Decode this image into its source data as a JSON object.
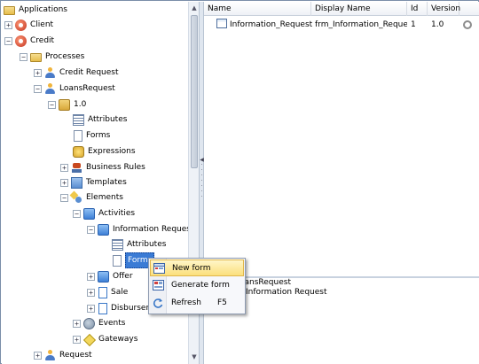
{
  "tree": {
    "nodes": [
      {
        "label": "Applications",
        "icon": "folder-icon"
      },
      {
        "label": "Client",
        "icon": "application-icon"
      },
      {
        "label": "Credit",
        "icon": "application-icon"
      },
      {
        "label": "Processes",
        "icon": "folder-icon"
      },
      {
        "label": "Credit Request",
        "icon": "process-icon"
      },
      {
        "label": "LoansRequest",
        "icon": "process-icon"
      },
      {
        "label": "1.0",
        "icon": "version-icon"
      },
      {
        "label": "Attributes",
        "icon": "attributes-icon"
      },
      {
        "label": "Forms",
        "icon": "forms-icon"
      },
      {
        "label": "Expressions",
        "icon": "expressions-icon"
      },
      {
        "label": "Business Rules",
        "icon": "business-rules-icon"
      },
      {
        "label": "Templates",
        "icon": "templates-icon"
      },
      {
        "label": "Elements",
        "icon": "elements-icon"
      },
      {
        "label": "Activities",
        "icon": "activities-icon"
      },
      {
        "label": "Information Request",
        "icon": "activity-icon"
      },
      {
        "label": "Attributes",
        "icon": "attributes-icon"
      },
      {
        "label": "Forms",
        "icon": "forms-icon"
      },
      {
        "label": "Offer",
        "icon": "activity-icon"
      },
      {
        "label": "Sale",
        "icon": "activity-icon"
      },
      {
        "label": "Disburseme",
        "icon": "activity-icon"
      },
      {
        "label": "Events",
        "icon": "events-icon"
      },
      {
        "label": "Gateways",
        "icon": "gateways-icon"
      },
      {
        "label": "Request",
        "icon": "process-icon"
      }
    ]
  },
  "list": {
    "columns": [
      "Name",
      "Display Name",
      "Id",
      "Version"
    ],
    "rows": [
      {
        "name": "Information_Request",
        "display_name": "frm_Information_Request",
        "id": "1",
        "version": "1.0"
      }
    ]
  },
  "details": {
    "line1": "oansRequest",
    "line2": "Information Request"
  },
  "context_menu": {
    "items": [
      {
        "label": "New form",
        "shortcut": ""
      },
      {
        "label": "Generate form",
        "shortcut": ""
      },
      {
        "label": "Refresh",
        "shortcut": "F5"
      }
    ]
  },
  "colors": {
    "selection": "#3a7bd5",
    "menu_highlight": "#fbdf7c",
    "border": "#7a8ea8"
  }
}
